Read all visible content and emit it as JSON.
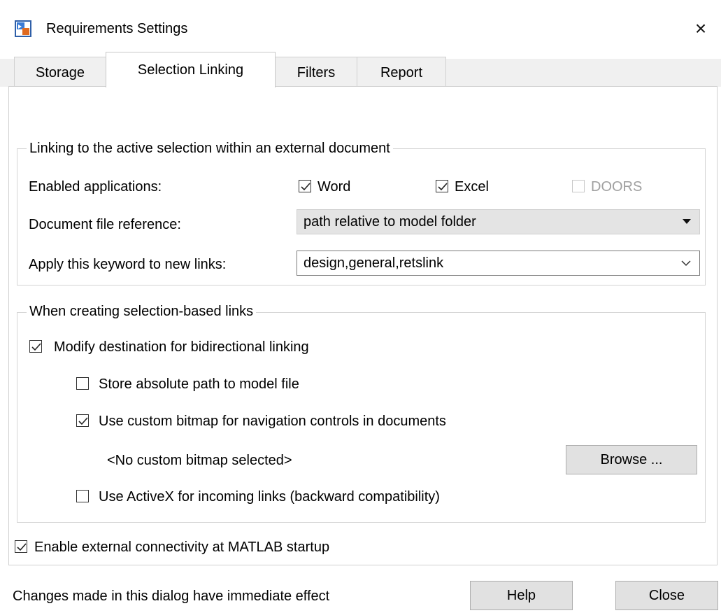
{
  "window": {
    "title": "Requirements Settings",
    "close_icon": "×",
    "icon": "app-icon"
  },
  "tabs": [
    {
      "label": "Storage",
      "active": false
    },
    {
      "label": "Selection Linking",
      "active": true
    },
    {
      "label": "Filters",
      "active": false
    },
    {
      "label": "Report",
      "active": false
    }
  ],
  "external_doc_group": {
    "legend": "Linking to the active selection within an external document",
    "enabled_apps_label": "Enabled applications:",
    "apps": [
      {
        "label": "Word",
        "checked": true,
        "enabled": true
      },
      {
        "label": "Excel",
        "checked": true,
        "enabled": true
      },
      {
        "label": "DOORS",
        "checked": false,
        "enabled": false
      }
    ],
    "doc_ref_label": "Document file reference:",
    "doc_ref_value": "path relative to model folder",
    "keyword_label": "Apply this keyword to new links:",
    "keyword_value": "design,general,retslink"
  },
  "selection_group": {
    "legend": "When creating selection-based links",
    "modify_dest": {
      "label": "Modify destination for bidirectional linking",
      "checked": true
    },
    "abs_path": {
      "label": "Store absolute path to model file",
      "checked": false
    },
    "custom_bitmap": {
      "label": "Use custom bitmap for navigation controls in documents",
      "checked": true
    },
    "bitmap_status": "<No custom bitmap selected>",
    "browse_label": "Browse ...",
    "activex": {
      "label": "Use ActiveX for incoming links (backward compatibility)",
      "checked": false
    }
  },
  "external_connectivity": {
    "label": "Enable external connectivity at MATLAB startup",
    "checked": true
  },
  "footer": {
    "status": "Changes made in this dialog have immediate effect",
    "help_label": "Help",
    "close_label": "Close"
  },
  "colors": {
    "face": "#f0f0f0",
    "button": "#e1e1e1",
    "combo": "#e4e4e4",
    "disabled": "#a0a0a0"
  }
}
